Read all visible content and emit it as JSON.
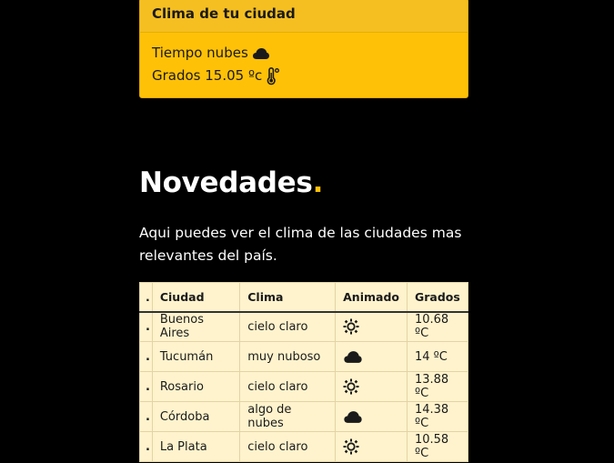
{
  "weather_card": {
    "title": "Clima de tu ciudad",
    "tiempo_text": "Tiempo nubes",
    "tiempo_icon": "cloud-icon",
    "grados_text": "Grados 15.05 ºc",
    "grados_icon": "thermometer-icon"
  },
  "novedades": {
    "title": "Novedades",
    "title_dot": ".",
    "description": "Aqui puedes ver el clima de las ciudades mas relevantes del país."
  },
  "table": {
    "headers": [
      ".",
      "Ciudad",
      "Clima",
      "Animado",
      "Grados"
    ],
    "rows": [
      {
        "marker": ".",
        "ciudad": "Buenos Aires",
        "clima": "cielo claro",
        "icon": "sun-icon",
        "grados": "10.68 ºC"
      },
      {
        "marker": ".",
        "ciudad": "Tucumán",
        "clima": "muy nuboso",
        "icon": "cloud-icon",
        "grados": "14 ºC"
      },
      {
        "marker": ".",
        "ciudad": "Rosario",
        "clima": "cielo claro",
        "icon": "sun-icon",
        "grados": "13.88 ºC"
      },
      {
        "marker": ".",
        "ciudad": "Córdoba",
        "clima": "algo de nubes",
        "icon": "cloud-icon",
        "grados": "14.38 ºC"
      },
      {
        "marker": ".",
        "ciudad": "La Plata",
        "clima": "cielo claro",
        "icon": "sun-icon",
        "grados": "10.58 ºC"
      }
    ]
  },
  "colors": {
    "background": "#000000",
    "accent": "#ffc107",
    "table_bg": "#fff3cd"
  }
}
